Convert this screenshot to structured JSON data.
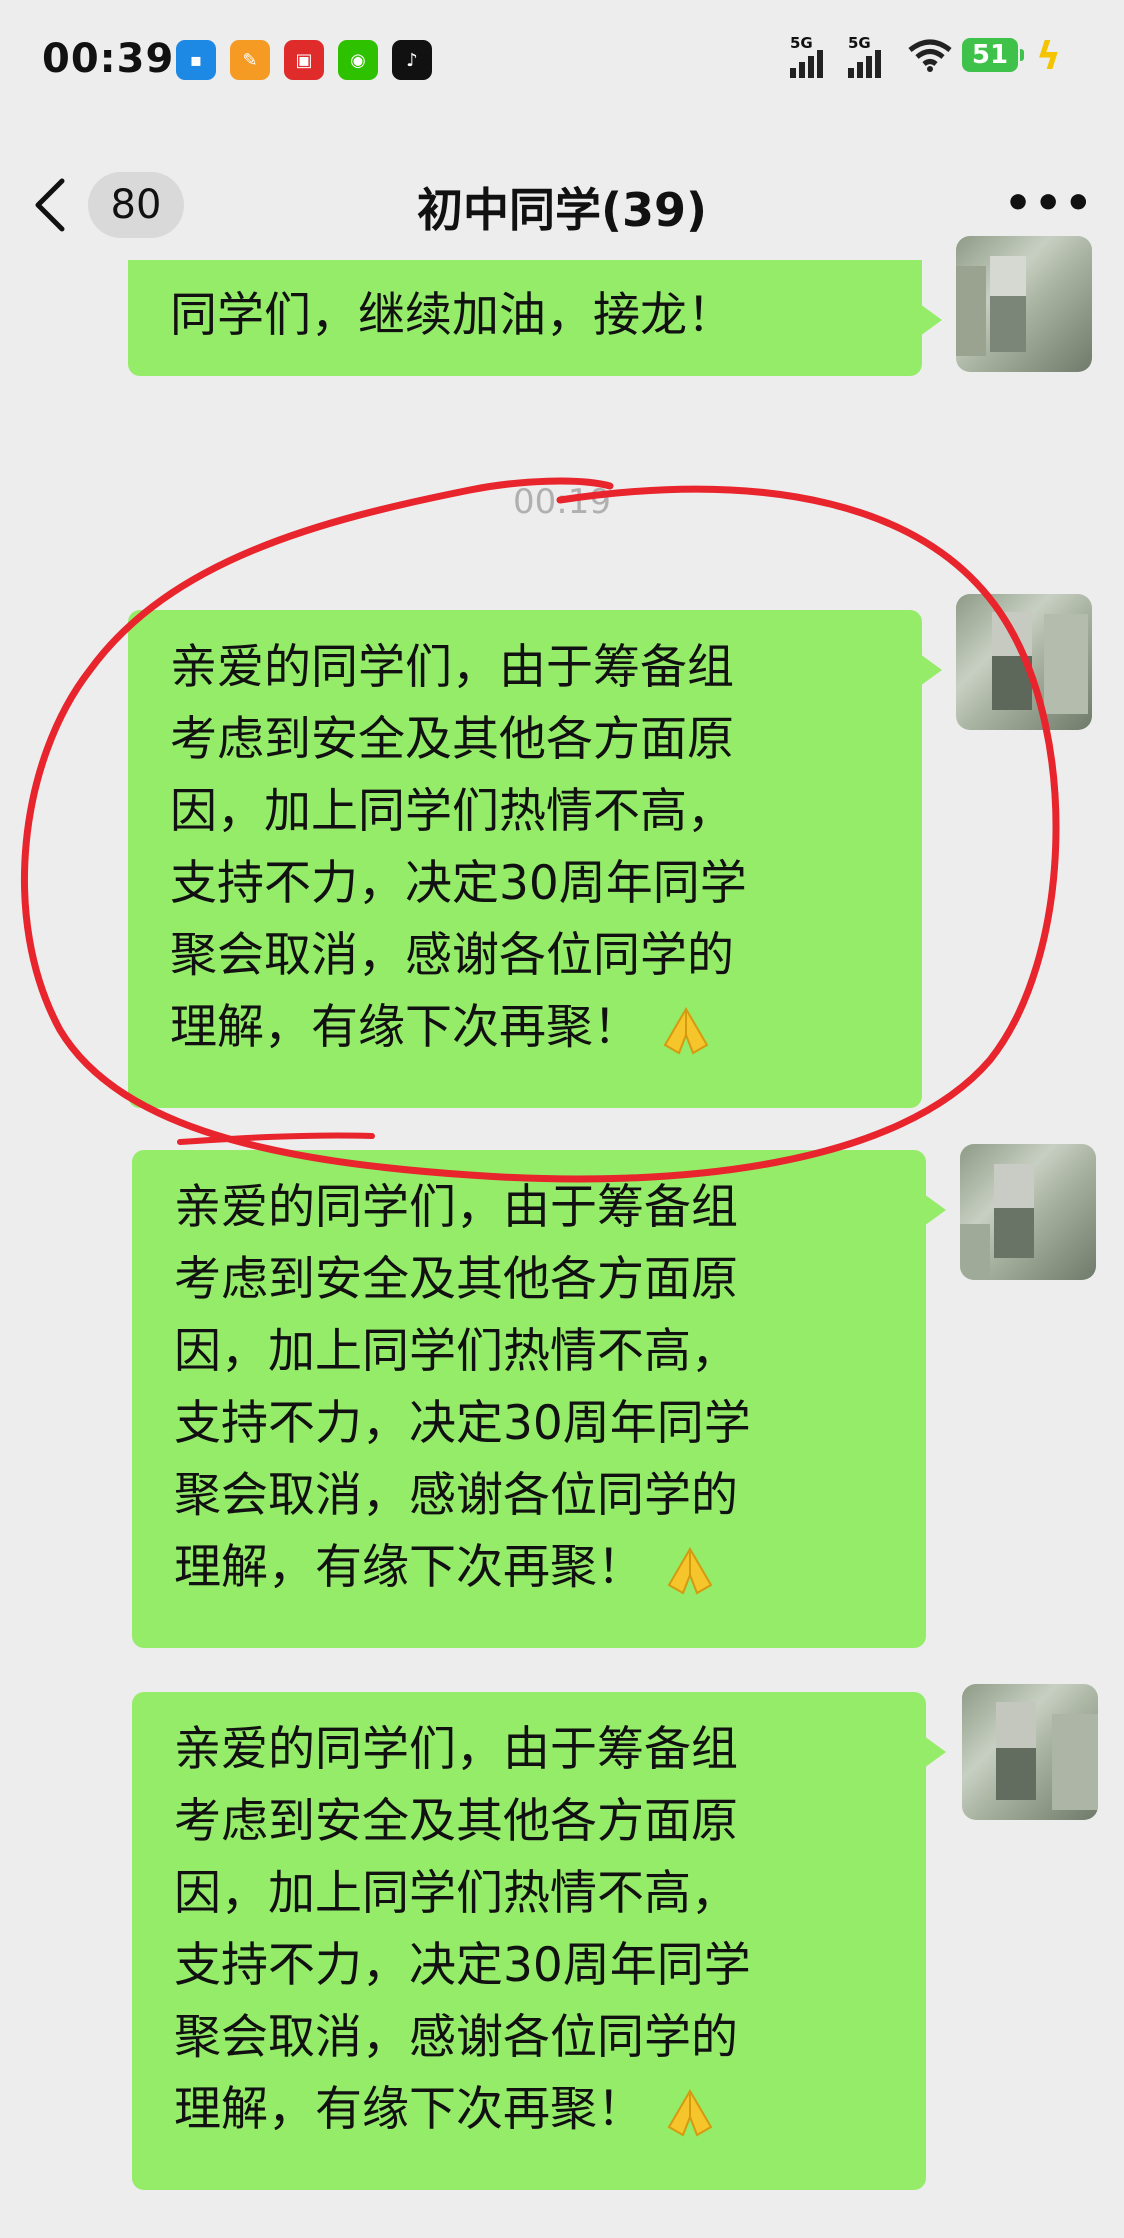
{
  "status_bar": {
    "time": "00:39",
    "signal_1": "5G",
    "signal_2": "5G",
    "battery": "51"
  },
  "header": {
    "unread_count": "80",
    "title": "初中同学(39)",
    "more": "•••"
  },
  "chat": {
    "timestamp": "00:19",
    "messages": [
      {
        "lines": [
          "同学们，继续加油，接龙！"
        ]
      },
      {
        "lines": [
          "亲爱的同学们，由于筹备组",
          "考虑到安全及其他各方面原",
          "因，加上同学们热情不高，",
          "支持不力，决定30周年同学",
          "聚会取消，感谢各位同学的",
          "理解，有缘下次再聚！"
        ]
      },
      {
        "lines": [
          "亲爱的同学们，由于筹备组",
          "考虑到安全及其他各方面原",
          "因，加上同学们热情不高，",
          "支持不力，决定30周年同学",
          "聚会取消，感谢各位同学的",
          "理解，有缘下次再聚！"
        ]
      },
      {
        "lines": [
          "亲爱的同学们，由于筹备组",
          "考虑到安全及其他各方面原",
          "因，加上同学们热情不高，",
          "支持不力，决定30周年同学",
          "聚会取消，感谢各位同学的",
          "理解，有缘下次再聚！"
        ]
      }
    ]
  },
  "colors": {
    "bubble": "#95ec69",
    "background": "#ededed",
    "annotation": "#e8242c"
  },
  "icons": [
    "back-chevron-icon",
    "more-icon",
    "folded-hands-emoji",
    "wifi-icon",
    "charging-bolt-icon"
  ]
}
